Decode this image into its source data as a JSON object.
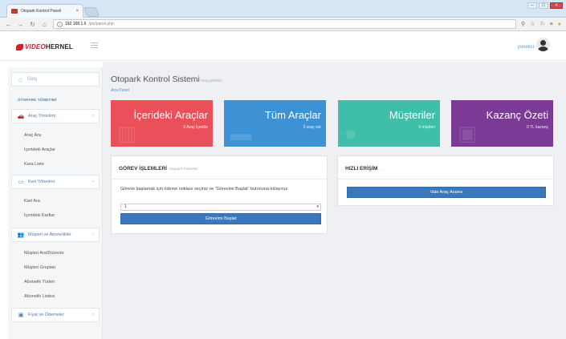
{
  "browser": {
    "tab_title": "Otopark Kontrol Paneli",
    "tab_close": "×",
    "url_host": "192.168.1.6",
    "url_path": "/pts/panel.php",
    "win_min": "–",
    "win_max": "□",
    "win_close": "×"
  },
  "header": {
    "logo_prefix": "VIDEO",
    "logo_suffix": "HERNEL",
    "username": "yonetici"
  },
  "sidebar": {
    "home_label": "Giriş",
    "section_label": "OTOPARK YÖNETİMİ",
    "groups": [
      {
        "label": "Araç Yönetimi",
        "items": [
          "Araç Ara",
          "İçerideki Araçlar",
          "Kara Liste"
        ]
      },
      {
        "label": "Kart Yönetimi",
        "items": [
          "Kart Ara",
          "İçerideki Kartlar"
        ]
      },
      {
        "label": "Müşteri ve Abonelikler",
        "items": [
          "Müşteri Ara/Düzenle",
          "Müşteri Grupları",
          "Abonelik Türleri",
          "Abonelik Listesi"
        ]
      },
      {
        "label": "Fiyat ve Ödemeler",
        "items": []
      }
    ]
  },
  "main": {
    "title": "Otopark Kontrol Sistemi",
    "subtitle": "Hoş geldiniz!",
    "breadcrumb": "Ana Panel",
    "stats": [
      {
        "title": "İçerideki Araçlar",
        "sub": "0 Araç İçeride",
        "color": "#e9505a"
      },
      {
        "title": "Tüm Araçlar",
        "sub": "0 araç var",
        "color": "#3d92d6"
      },
      {
        "title": "Müşteriler",
        "sub": "0 müşteri",
        "color": "#3fbfaa"
      },
      {
        "title": "Kazanç Özeti",
        "sub": "0 TL kazanç",
        "color": "#7b3a95"
      }
    ],
    "task_panel": {
      "title": "GÖREV İŞLEMLERİ",
      "subtitle": "Otopark Görevleri",
      "text": "Göreve başlamak için ödeme noktası seçiniz ve \"Görevimi Başlat\" butonuna tıklayınız.",
      "select_value": "1",
      "button": "Görevimi Başlat"
    },
    "quick_panel": {
      "title": "HIZLI ERİŞİM",
      "subtitle": "...",
      "button": "Vale Araç Arama"
    }
  }
}
